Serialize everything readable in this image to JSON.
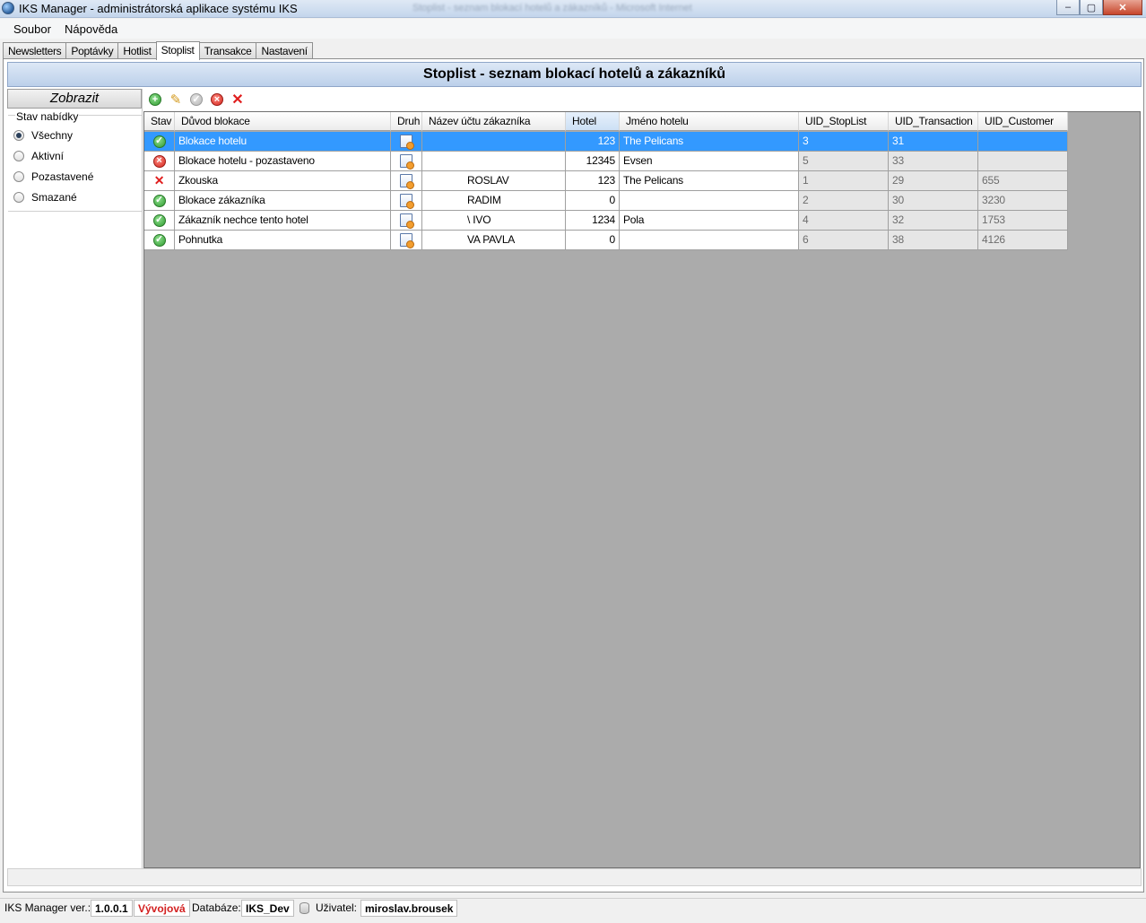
{
  "window": {
    "title": "IKS Manager - administrátorská aplikace systému IKS",
    "ghost_title": "Stoplist - seznam blokací hotelů a zákazníků - Microsoft Internet",
    "buttons": {
      "minimize": "–",
      "maximize": "▢",
      "close": "✕"
    }
  },
  "menu": {
    "items": [
      "Soubor",
      "Nápověda"
    ]
  },
  "tabs": {
    "items": [
      "Newsletters",
      "Poptávky",
      "Hotlist",
      "Stoplist",
      "Transakce",
      "Nastavení"
    ],
    "active": "Stoplist"
  },
  "page": {
    "title": "Stoplist - seznam blokací hotelů a zákazníků"
  },
  "left_panel": {
    "header": "Zobrazit",
    "group_label": "Stav nabídky",
    "options": [
      "Všechny",
      "Aktivní",
      "Pozastavené",
      "Smazané"
    ],
    "selected": "Všechny"
  },
  "toolbar": {
    "icons": [
      "add-icon",
      "edit-icon",
      "approve-icon",
      "suspend-icon",
      "delete-icon"
    ]
  },
  "grid": {
    "columns": [
      "Stav",
      "Důvod blokace",
      "Druh",
      "Název účtu zákazníka",
      "Hotel",
      "Jméno hotelu",
      "UID_StopList",
      "UID_Transaction",
      "UID_Customer"
    ],
    "sorted_column": "Hotel",
    "rows": [
      {
        "stav": "active",
        "duvod": "Blokace hotelu",
        "druh": "hotel",
        "zakaznik": "",
        "hotel": "123",
        "jmeno": "The Pelicans",
        "uid_stoplist": "3",
        "uid_transaction": "31",
        "uid_customer": ""
      },
      {
        "stav": "suspended",
        "duvod": "Blokace hotelu - pozastaveno",
        "druh": "hotel-doc",
        "zakaznik": "",
        "hotel": "12345",
        "jmeno": "Evsen",
        "uid_stoplist": "5",
        "uid_transaction": "33",
        "uid_customer": ""
      },
      {
        "stav": "deleted",
        "duvod": "Zkouska",
        "druh": "hotel",
        "zakaznik": "ROSLAV",
        "hotel": "123",
        "jmeno": "The Pelicans",
        "uid_stoplist": "1",
        "uid_transaction": "29",
        "uid_customer": "655"
      },
      {
        "stav": "active",
        "duvod": "Blokace zákazníka",
        "druh": "customer",
        "zakaznik": "RADIM",
        "hotel": "0",
        "jmeno": "",
        "uid_stoplist": "2",
        "uid_transaction": "30",
        "uid_customer": "3230"
      },
      {
        "stav": "active",
        "duvod": "Zákazník nechce tento hotel",
        "druh": "hotel",
        "zakaznik": "\\ IVO",
        "hotel": "1234",
        "jmeno": "Pola",
        "uid_stoplist": "4",
        "uid_transaction": "32",
        "uid_customer": "1753"
      },
      {
        "stav": "active",
        "duvod": "Pohnutka",
        "druh": "customer",
        "zakaznik": "VA PAVLA",
        "hotel": "0",
        "jmeno": "",
        "uid_stoplist": "6",
        "uid_transaction": "38",
        "uid_customer": "4126"
      }
    ],
    "selected_row": 0
  },
  "statusbar": {
    "version_label": "IKS Manager ver.:",
    "version": "1.0.0.1",
    "env": "Vývojová",
    "db_label": "Databáze:",
    "db": "IKS_Dev",
    "user_label": "Uživatel:",
    "user": "miroslav.brousek"
  },
  "colors": {
    "selection": "#3399ff",
    "header_blue": "#bcd0ea",
    "env_red": "#d32020",
    "grid_bg": "#ababab"
  }
}
